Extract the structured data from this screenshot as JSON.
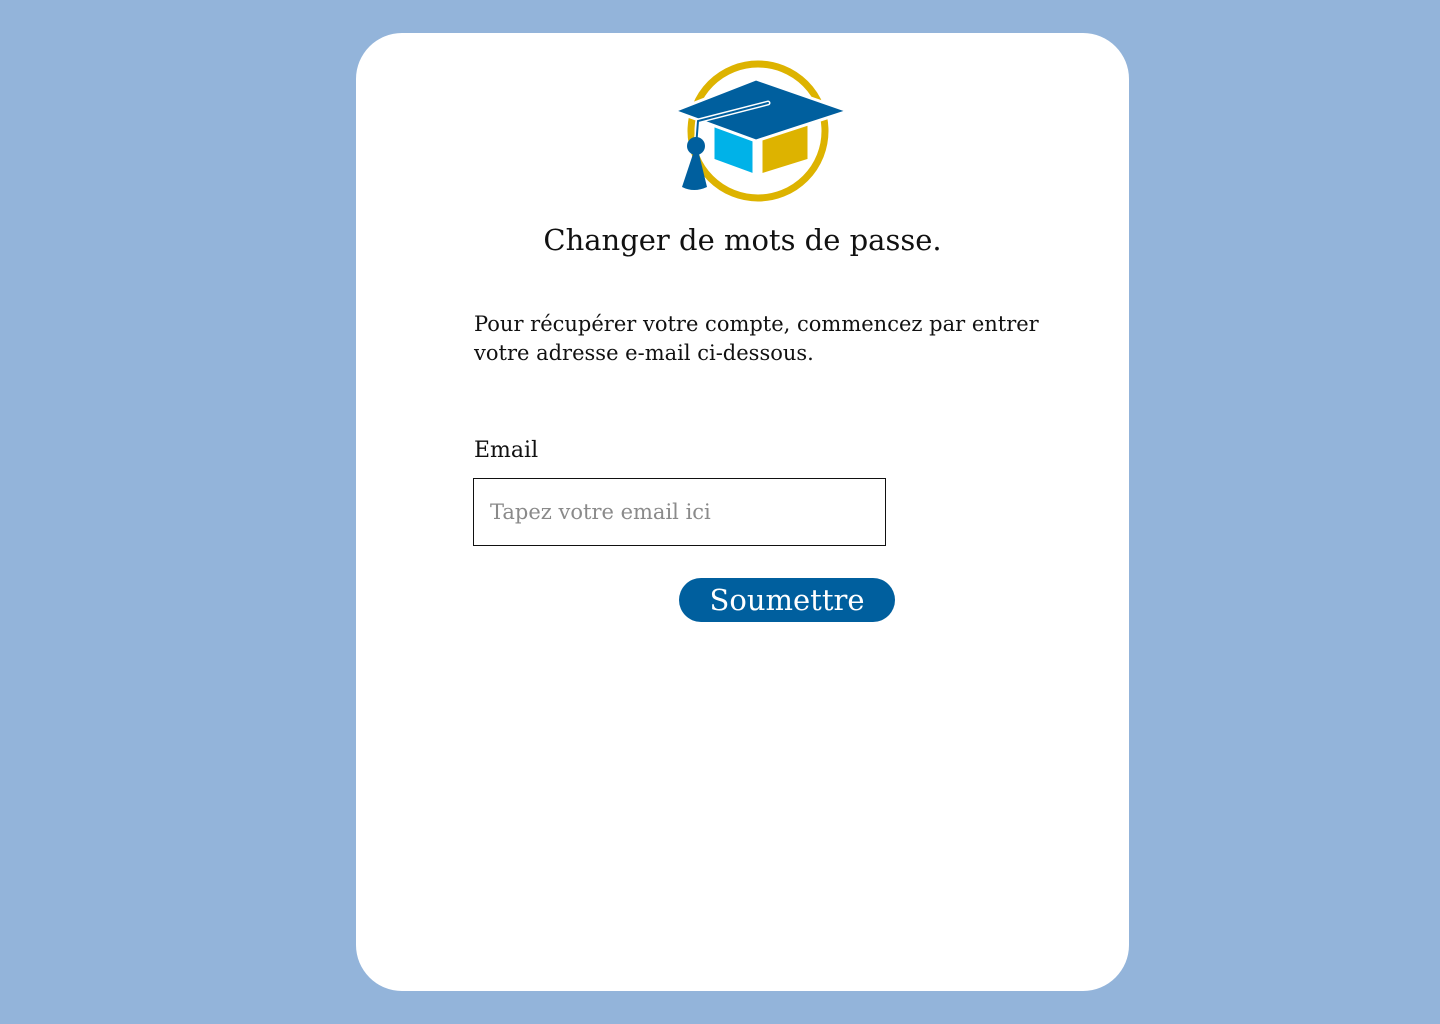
{
  "logo": {
    "icon": "graduation-cap-icon",
    "colors": {
      "blue": "#005f9e",
      "light_blue": "#00b2e8",
      "gold": "#ddb300"
    }
  },
  "page": {
    "title": "Changer de mots de passe.",
    "intro": "Pour récupérer votre compte, commencez par entrer votre adresse e-mail ci-dessous."
  },
  "form": {
    "email_label": "Email",
    "email_placeholder": "Tapez votre email ici",
    "email_value": "",
    "submit_label": "Soumettre"
  },
  "colors": {
    "background": "#93b4da",
    "card": "#ffffff",
    "button": "#005f9e"
  }
}
